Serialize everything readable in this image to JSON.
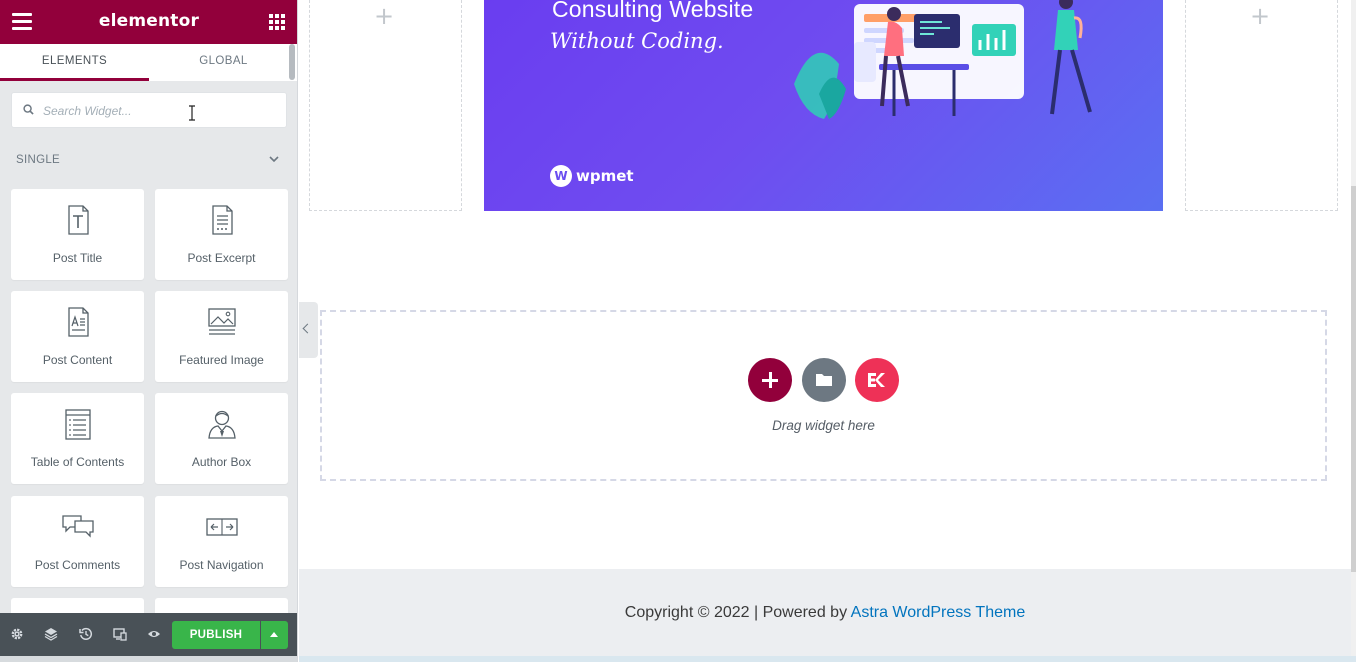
{
  "app": {
    "brand": "elementor",
    "icons": {
      "menu": "hamburger-icon",
      "apps": "grid-apps-icon"
    },
    "accent_color": "#92003b",
    "publish_color": "#39b54a"
  },
  "tabs": [
    {
      "label": "ELEMENTS",
      "active": true
    },
    {
      "label": "GLOBAL",
      "active": false
    }
  ],
  "search": {
    "placeholder": "Search Widget...",
    "value": ""
  },
  "section": {
    "title": "SINGLE",
    "expanded": true
  },
  "widgets": [
    {
      "label": "Post Title",
      "icon": "post-title-icon"
    },
    {
      "label": "Post Excerpt",
      "icon": "post-excerpt-icon"
    },
    {
      "label": "Post Content",
      "icon": "post-content-icon"
    },
    {
      "label": "Featured Image",
      "icon": "featured-image-icon"
    },
    {
      "label": "Table of Contents",
      "icon": "table-of-contents-icon"
    },
    {
      "label": "Author Box",
      "icon": "author-box-icon"
    },
    {
      "label": "Post Comments",
      "icon": "post-comments-icon"
    },
    {
      "label": "Post Navigation",
      "icon": "post-navigation-icon"
    }
  ],
  "footer_bar": {
    "icons": [
      "settings-icon",
      "navigator-layers-icon",
      "history-icon",
      "responsive-mode-icon",
      "preview-eye-icon"
    ],
    "publish_label": "PUBLISH"
  },
  "banner": {
    "title": "Consulting Website",
    "subtitle": "Without Coding.",
    "logo_text": "wpmet"
  },
  "dropzone": {
    "label": "Drag widget here",
    "buttons": [
      "add-section-icon",
      "template-library-folder-icon",
      "elementskit-icon"
    ]
  },
  "site_footer": {
    "text": "Copyright © 2022 | Powered by ",
    "link": "Astra WordPress Theme"
  }
}
